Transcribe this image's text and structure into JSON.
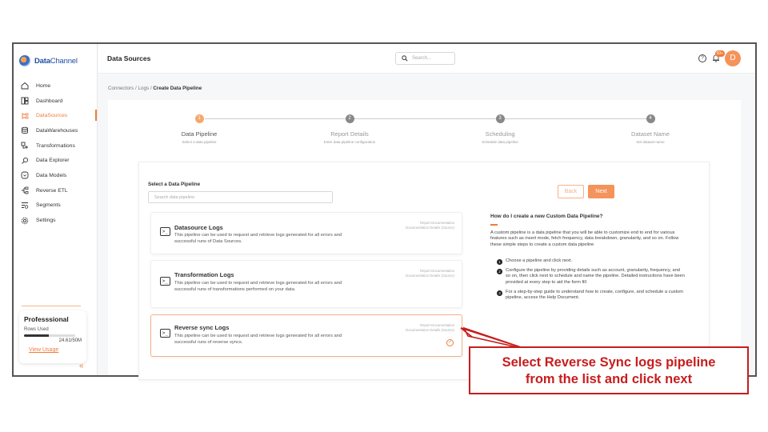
{
  "app": {
    "brand": {
      "name_bold": "Data",
      "name_rest": "Channel"
    }
  },
  "sidebar": {
    "items": [
      {
        "label": "Home",
        "icon": "home-icon"
      },
      {
        "label": "Dashboard",
        "icon": "dashboard-icon"
      },
      {
        "label": "DataSources",
        "icon": "datasources-icon",
        "active": true
      },
      {
        "label": "DataWarehouses",
        "icon": "database-icon"
      },
      {
        "label": "Transformations",
        "icon": "transform-icon"
      },
      {
        "label": "Data Explorer",
        "icon": "explorer-icon"
      },
      {
        "label": "Data Models",
        "icon": "models-icon"
      },
      {
        "label": "Reverse ETL",
        "icon": "reverse-etl-icon"
      },
      {
        "label": "Segments",
        "icon": "segments-icon"
      },
      {
        "label": "Settings",
        "icon": "gear-icon"
      }
    ],
    "plan": {
      "name": "Professsional",
      "rows_label": "Rows Used",
      "rows_count": "24.61/50M",
      "usage_fraction": 0.49,
      "view_usage": "View Usage"
    },
    "collapse_glyph": "«"
  },
  "header": {
    "title": "Data Sources",
    "search_placeholder": "Search...",
    "help_glyph": "?",
    "notifications_badge": "99+",
    "avatar_initial": "D"
  },
  "breadcrumb": {
    "items": [
      "Connectors",
      "Logs"
    ],
    "separator": "/",
    "current": "Create Data Pipeline"
  },
  "stepper": {
    "steps": [
      {
        "num": "1",
        "title": "Data Pipeline",
        "sub": "Select a data pipeline",
        "active": true
      },
      {
        "num": "2",
        "title": "Report Details",
        "sub": "Enter data pipeline configuration"
      },
      {
        "num": "3",
        "title": "Scheduling",
        "sub": "Schedule data pipeline"
      },
      {
        "num": "4",
        "title": "Dataset Name",
        "sub": "Set dataset name"
      }
    ]
  },
  "pipeline_select": {
    "label": "Select a Data Pipeline",
    "search_placeholder": "Search data pipeline",
    "links": {
      "report": "Report Documentation",
      "details": "Documentation Details (Source)"
    },
    "options": [
      {
        "title": "Datasource Logs",
        "desc": "This pipeline can be used to request and retrieve logs generated for all errors and successful runs of Data Sources."
      },
      {
        "title": "Transformation Logs",
        "desc": "This pipeline can be used to request and retrieve logs generated for all errors and successful runs of transformations performed on your data."
      },
      {
        "title": "Reverse sync Logs",
        "desc": "This pipeline can be used to request and retrieve logs generated for all errors and successful runs of reverse syncs.",
        "selected": true
      }
    ]
  },
  "buttons": {
    "back": "Back",
    "next": "Next"
  },
  "help": {
    "title": "How do I create a new Custom Data Pipeline?",
    "body": "A custom pipeline is a data pipeline that you will be able to customize end to end for various features such as insert mode, fetch frequency, data breakdown, granularity, and so on. Follow these simple steps to create a custom data pipeline",
    "steps": [
      {
        "num": "1",
        "text": "Choose a pipeline and click next."
      },
      {
        "num": "2",
        "text": "Configure the pipeline by providing details such as account, granularity, frequency, and so on, then click next to schedule and name the pipeline. Detailed instructions have been provided at every step to aid the form fill"
      },
      {
        "num": "3",
        "text": "For a step-by-step guide to understand how to create, configure, and schedule a custom pipeline, access the Help Document."
      }
    ]
  },
  "callout": {
    "line1": "Select Reverse Sync logs pipeline",
    "line2": "from the list and click next",
    "color": "#c81d1d"
  },
  "theme": {
    "accent": "#f07c3a",
    "brand_blue": "#1e4fa5"
  }
}
